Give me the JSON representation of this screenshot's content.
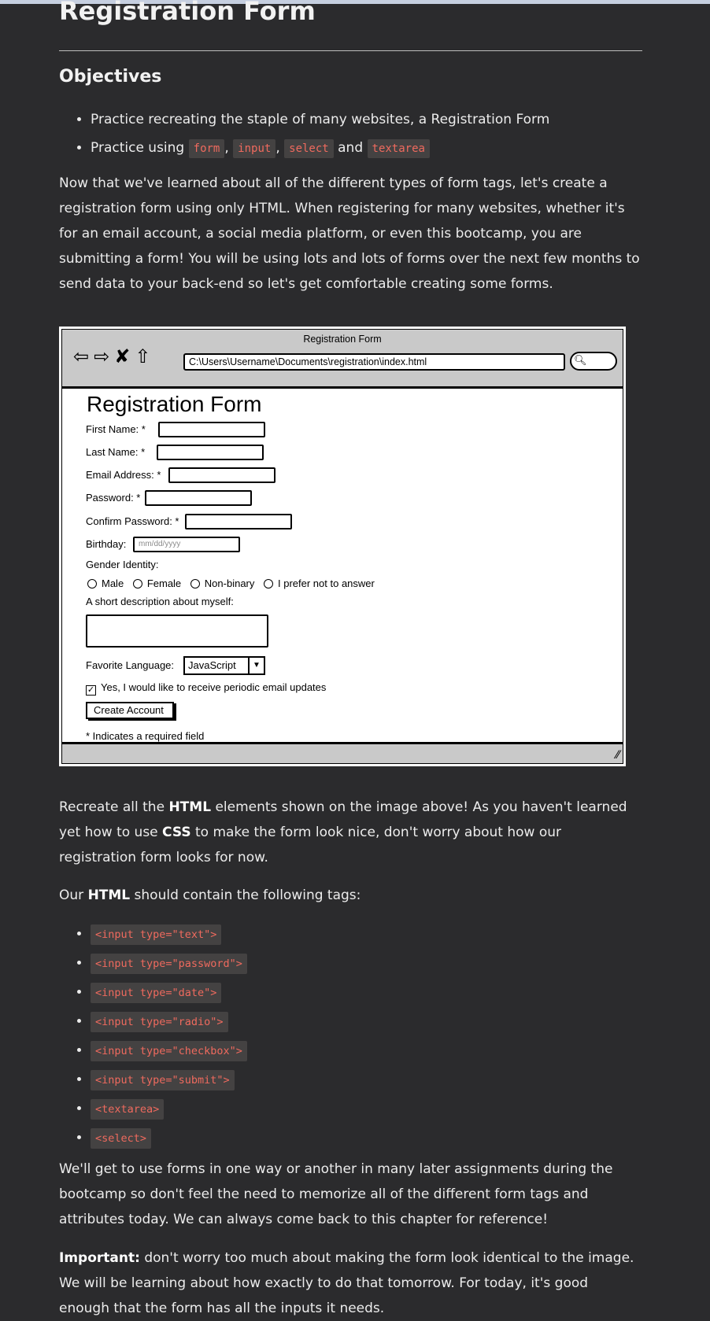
{
  "page": {
    "title": "Registration Form",
    "objectives_heading": "Objectives",
    "objectives": {
      "item1": "Practice recreating the staple of many websites, a Registration Form",
      "item2_prefix": "Practice using",
      "codes": [
        "form",
        "input",
        "select",
        "textarea"
      ],
      "and": "and"
    },
    "intro": "Now that we've learned about all of the different types of form tags, let's create a registration form using only HTML. When registering for many websites, whether it's for an email account, a social media platform, or even this bootcamp, you are submitting a form! You will be using lots and lots of forms over the next few months to send data to your back-end so let's get comfortable creating some forms.",
    "recreate": {
      "part1": "Recreate all the",
      "html": "HTML",
      "part2": "elements shown on the image above! As you haven't learned yet how to use",
      "css": "CSS",
      "part3": "to make the form look nice, don't worry about how our registration form looks for now."
    },
    "tags_intro": {
      "part1": "Our",
      "html": "HTML",
      "part2": "should contain the following tags:"
    },
    "tags": [
      "<input type=\"text\">",
      "<input type=\"password\">",
      "<input type=\"date\">",
      "<input type=\"radio\">",
      "<input type=\"checkbox\">",
      "<input type=\"submit\">",
      "<textarea>",
      "<select>"
    ],
    "later": "We'll get to use forms in one way or another in many later assignments during the bootcamp so don't feel the need to memorize all of the different form tags and attributes today. We can always come back to this chapter for reference!",
    "important_label": "Important:",
    "important": "don't worry too much about making the form look identical to the image. We will be learning about how exactly to do that tomorrow. For today, it's good enough that the form has all the inputs it needs."
  },
  "mockup": {
    "window_title": "Registration Form",
    "url": "C:\\Users\\Username\\Documents\\registration\\index.html",
    "form_title": "Registration Form",
    "first_name": "First Name: *",
    "last_name": "Last Name: *",
    "email": "Email Address: *",
    "password": "Password: *",
    "confirm_password": "Confirm Password: *",
    "birthday": "Birthday:",
    "birthday_placeholder": "mm/dd/yyyy",
    "gender_label": "Gender Identity:",
    "genders": [
      "Male",
      "Female",
      "Non-binary",
      "I prefer not to answer"
    ],
    "description_label": "A short description about myself:",
    "language_label": "Favorite Language:",
    "language_value": "JavaScript",
    "updates_label": "Yes, I would like to receive periodic email updates",
    "updates_checked": true,
    "create_button": "Create Account",
    "required_note": "* Indicates a required field",
    "icons": [
      "back-arrow-icon",
      "forward-arrow-icon",
      "close-x-icon",
      "home-icon",
      "search-icon",
      "resize-grip-icon"
    ]
  }
}
